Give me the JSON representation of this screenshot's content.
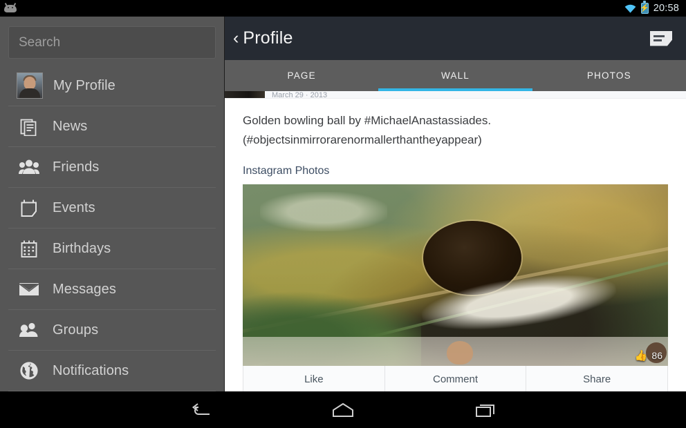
{
  "statusbar": {
    "notification_icon": "android-robot-icon",
    "wifi_icon": "wifi-icon",
    "battery_icon": "battery-charging-icon",
    "clock": "20:58"
  },
  "drawer": {
    "search": {
      "placeholder": "Search",
      "value": ""
    },
    "items": [
      {
        "label": "My Profile",
        "icon": "avatar"
      },
      {
        "label": "News",
        "icon": "news-icon"
      },
      {
        "label": "Friends",
        "icon": "friends-icon"
      },
      {
        "label": "Events",
        "icon": "events-icon"
      },
      {
        "label": "Birthdays",
        "icon": "birthdays-icon"
      },
      {
        "label": "Messages",
        "icon": "messages-icon"
      },
      {
        "label": "Groups",
        "icon": "groups-icon"
      },
      {
        "label": "Notifications",
        "icon": "notifications-globe-icon"
      }
    ]
  },
  "appbar": {
    "back_chevron": "‹",
    "title": "Profile",
    "menu_icon": "compose-icon"
  },
  "tabs": [
    {
      "label": "PAGE",
      "active": false
    },
    {
      "label": "WALL",
      "active": true
    },
    {
      "label": "PHOTOS",
      "active": false
    }
  ],
  "post": {
    "clipped_meta": "March 29 · 2013",
    "text_line_1": "Golden bowling ball by #MichaelAnastassiades.",
    "text_line_2": "(#objectsinmirrorarenormallerthantheyappear)",
    "album_link": "Instagram Photos",
    "photo_alt": "golden mirrored bowling ball reflecting foliage and a person",
    "like_count": "86",
    "like_icon": "thumbs-up-icon"
  },
  "actions": [
    {
      "label": "Like"
    },
    {
      "label": "Comment"
    },
    {
      "label": "Share"
    }
  ],
  "navbar": [
    {
      "icon": "back-icon"
    },
    {
      "icon": "home-icon"
    },
    {
      "icon": "recents-icon"
    }
  ],
  "colors": {
    "accent_blue": "#33b5e5",
    "appbar_dark": "#262b33",
    "drawer_gray": "#565656",
    "tabbar_gray": "#5d5d5d",
    "link_blue": "#3d4d63"
  }
}
